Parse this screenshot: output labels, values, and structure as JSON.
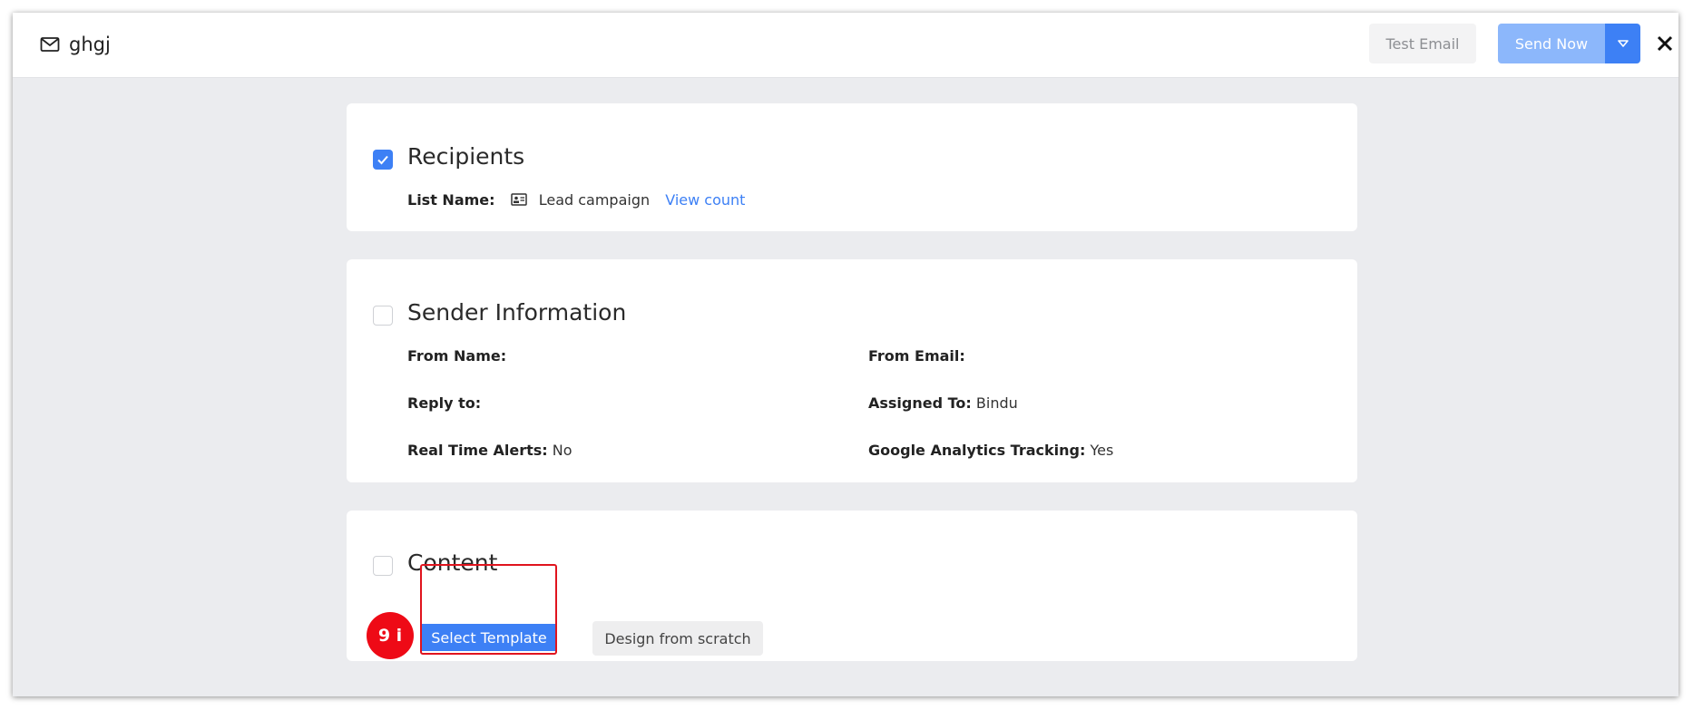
{
  "header": {
    "title": "ghgj",
    "test_email_label": "Test Email",
    "send_now_label": "Send Now"
  },
  "recipients": {
    "title": "Recipients",
    "checked": true,
    "list_name_label": "List Name:",
    "list_name_value": "Lead campaign",
    "view_count_label": "View count"
  },
  "sender": {
    "title": "Sender Information",
    "checked": false,
    "from_name_label": "From Name:",
    "from_name_value": "",
    "from_email_label": "From Email:",
    "from_email_value": "",
    "reply_to_label": "Reply to:",
    "reply_to_value": "",
    "assigned_to_label": "Assigned To:",
    "assigned_to_value": "Bindu",
    "alerts_label": "Real Time Alerts:",
    "alerts_value": "No",
    "ga_label": "Google Analytics Tracking:",
    "ga_value": "Yes"
  },
  "content": {
    "title": "Content",
    "checked": false,
    "select_template_label": "Select Template",
    "design_scratch_label": "Design from scratch"
  },
  "annotation": {
    "step_badge": "9 i",
    "highlight_color": "#e0141e"
  },
  "colors": {
    "primary": "#3d80f5",
    "primary_disabled": "#8cb7fb",
    "background": "#ebecef"
  },
  "icons": {
    "title": "mail-icon",
    "list": "contact-card-icon",
    "caret": "caret-down-icon",
    "close": "close-icon",
    "check": "check-icon"
  }
}
